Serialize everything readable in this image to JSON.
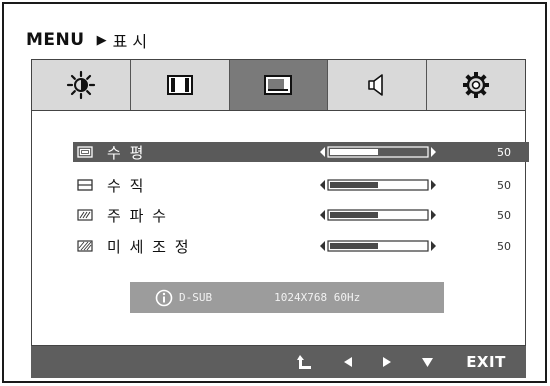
{
  "breadcrumb": {
    "menu": "MENU",
    "arrow": "▶",
    "current": "표 시"
  },
  "tabs": [
    {
      "icon": "brightness-icon",
      "active": false
    },
    {
      "icon": "picture-icon",
      "active": false
    },
    {
      "icon": "display-icon",
      "active": true
    },
    {
      "icon": "speaker-icon",
      "active": false
    },
    {
      "icon": "settings-icon",
      "active": false
    }
  ],
  "rows": [
    {
      "label": "수 평",
      "value": "50",
      "level": 0.5,
      "selected": true,
      "icon": "horizontal-position-icon"
    },
    {
      "label": "수 직",
      "value": "50",
      "level": 0.5,
      "selected": false,
      "icon": "vertical-position-icon"
    },
    {
      "label": "주 파 수",
      "value": "50",
      "level": 0.5,
      "selected": false,
      "icon": "clock-icon"
    },
    {
      "label": "미 세 조 정",
      "value": "50",
      "level": 0.5,
      "selected": false,
      "icon": "phase-icon"
    }
  ],
  "source": {
    "name": "D-SUB",
    "resolution": "1024X768  60Hz",
    "icon": "info-icon"
  },
  "footer": {
    "buttons": [
      {
        "icon": "return-icon"
      },
      {
        "icon": "left-arrow-icon"
      },
      {
        "icon": "right-arrow-icon"
      },
      {
        "icon": "down-arrow-icon"
      }
    ],
    "exit_label": "EXIT"
  },
  "colors": {
    "active_tab": "#7a7a7a",
    "tab": "#d9d9d9",
    "selected_row": "#5a5a5a",
    "footer": "#5e5e5e",
    "source_box": "#9c9c9c"
  }
}
